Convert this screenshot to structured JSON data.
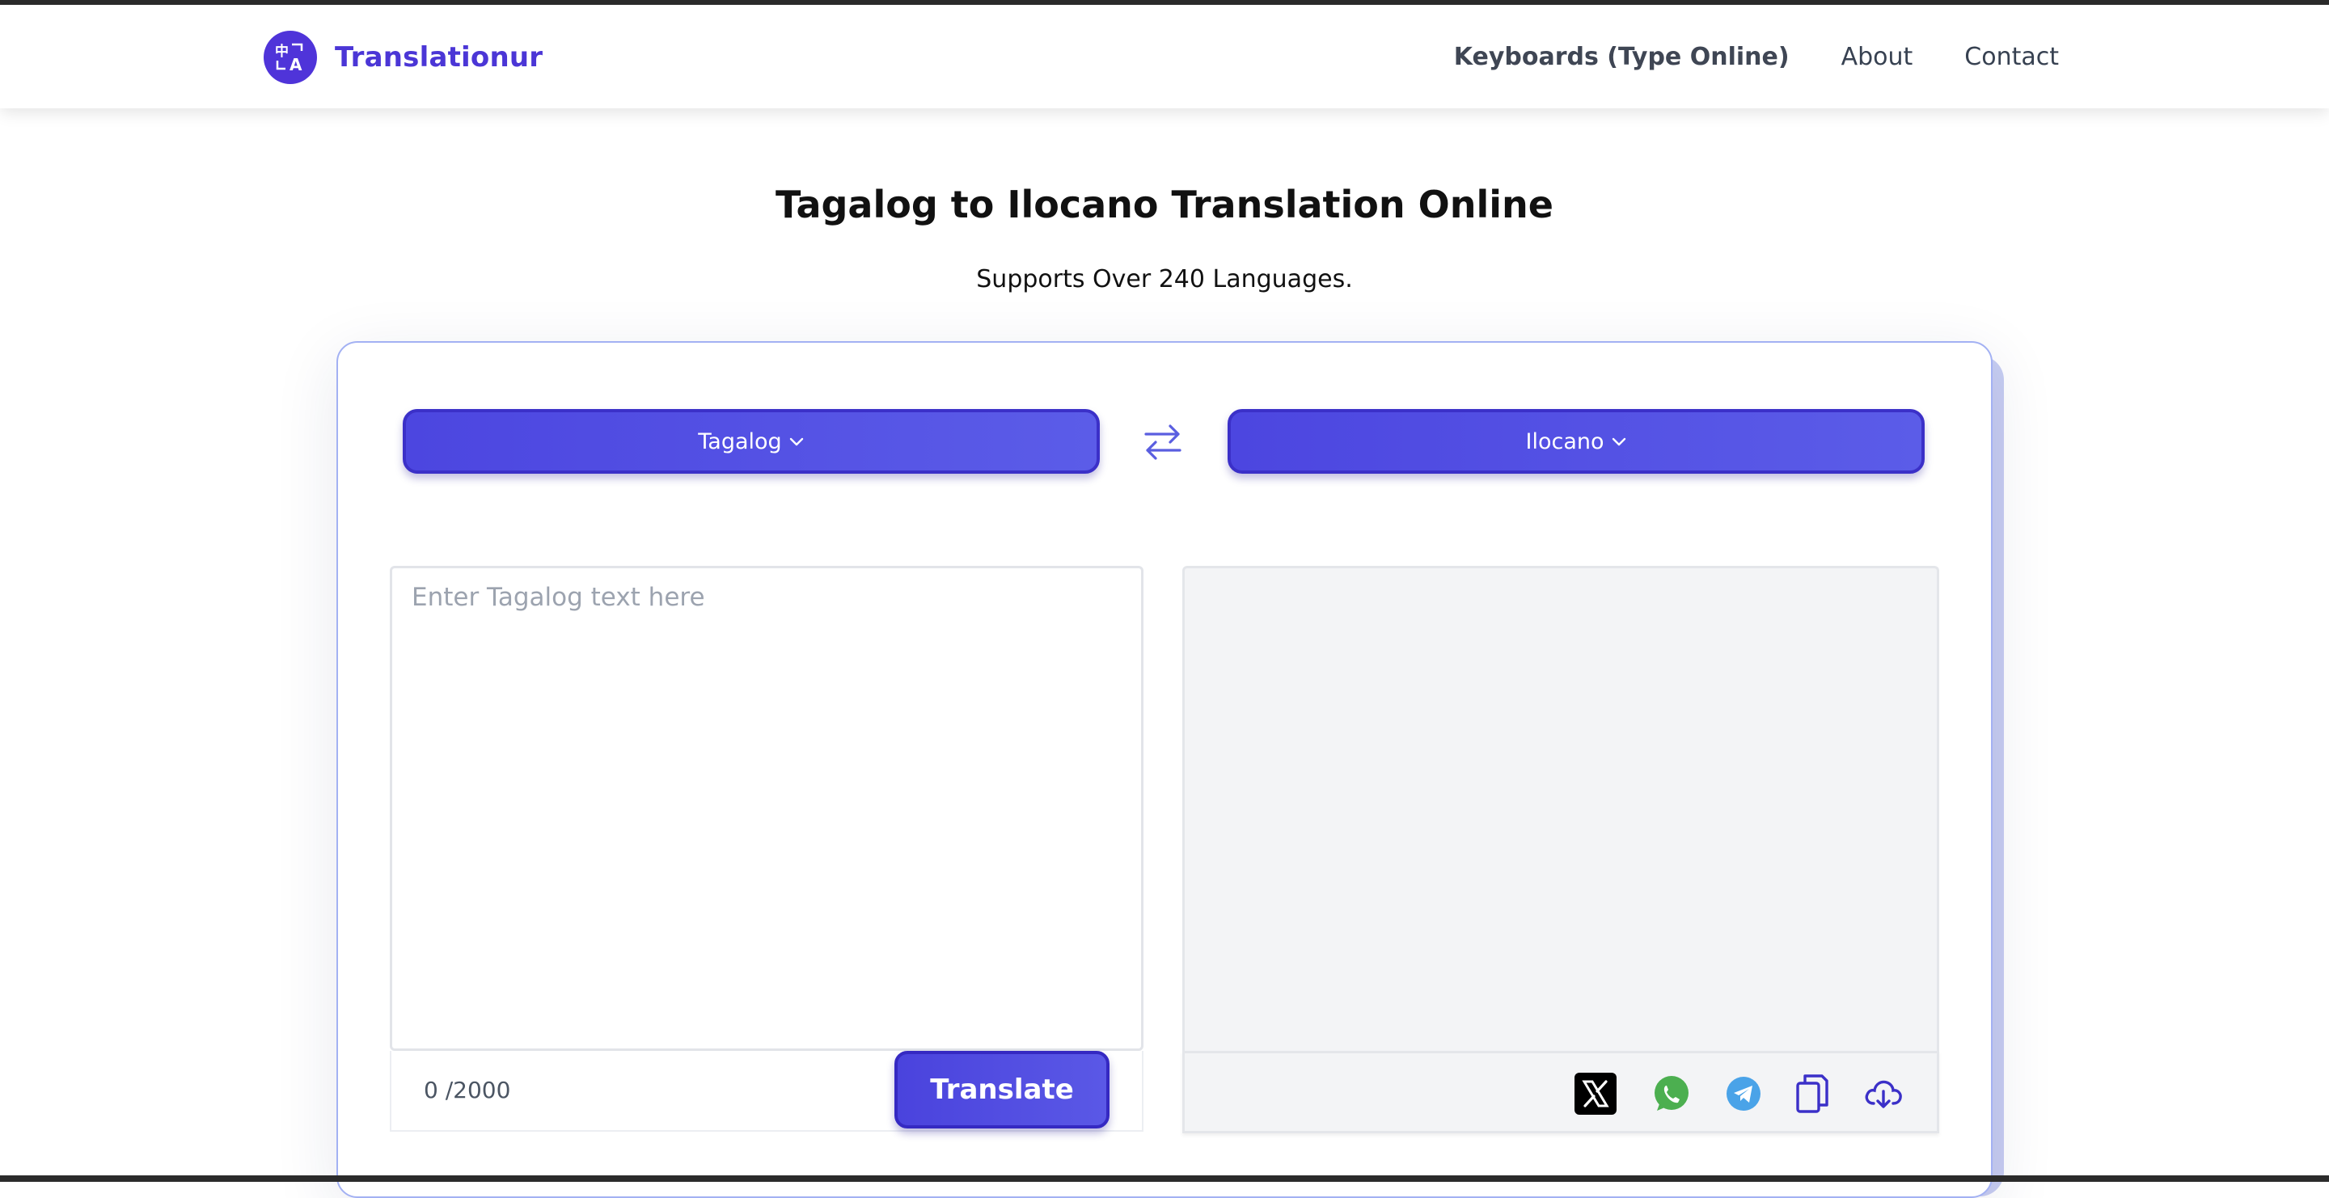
{
  "brand": {
    "name": "Translationur",
    "logo_icon": "translate-icon"
  },
  "nav": {
    "items": [
      {
        "label": "Keyboards (Type Online)"
      },
      {
        "label": "About"
      },
      {
        "label": "Contact"
      }
    ]
  },
  "hero": {
    "title": "Tagalog to Ilocano Translation Online",
    "subtitle": "Supports Over 240 Languages."
  },
  "translator": {
    "source_language": "Tagalog",
    "target_language": "Ilocano",
    "swap_icon": "swap-arrows-icon",
    "input_value": "",
    "input_placeholder": "Enter Tagalog text here",
    "counter": "0 /2000",
    "translate_label": "Translate",
    "output_value": "",
    "share_icons": [
      "x-twitter-icon",
      "whatsapp-icon",
      "telegram-icon",
      "copy-icon",
      "cloud-download-icon"
    ]
  },
  "colors": {
    "accent": "#4f46e5",
    "brand_text": "#4b36d6",
    "whatsapp": "#4caf50",
    "telegram": "#4aa3e8"
  }
}
